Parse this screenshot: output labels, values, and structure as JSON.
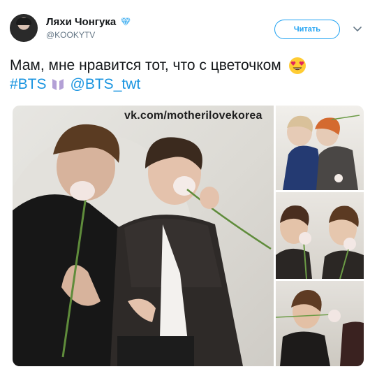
{
  "author": {
    "display_name": "Ляхи Чонгука",
    "handle": "@KOOKYTV",
    "verified_color": "#1da1f2"
  },
  "actions": {
    "follow_label": "Читать",
    "menu_icon": "chevron-down-icon"
  },
  "tweet": {
    "text_line1": "Мам, мне нравится тот, что с цветочком",
    "emoji": "heart-eyes-emoji",
    "hashtag": "#BTS",
    "hashtag_emoji": "bts-logo-emoji",
    "mention": "@BTS_twt",
    "link_color": "#1b95e0"
  },
  "media": {
    "watermark": "vk.com/motherilovekorea",
    "images": [
      "main-photo",
      "side-photo-1",
      "side-photo-2",
      "side-photo-3"
    ]
  }
}
